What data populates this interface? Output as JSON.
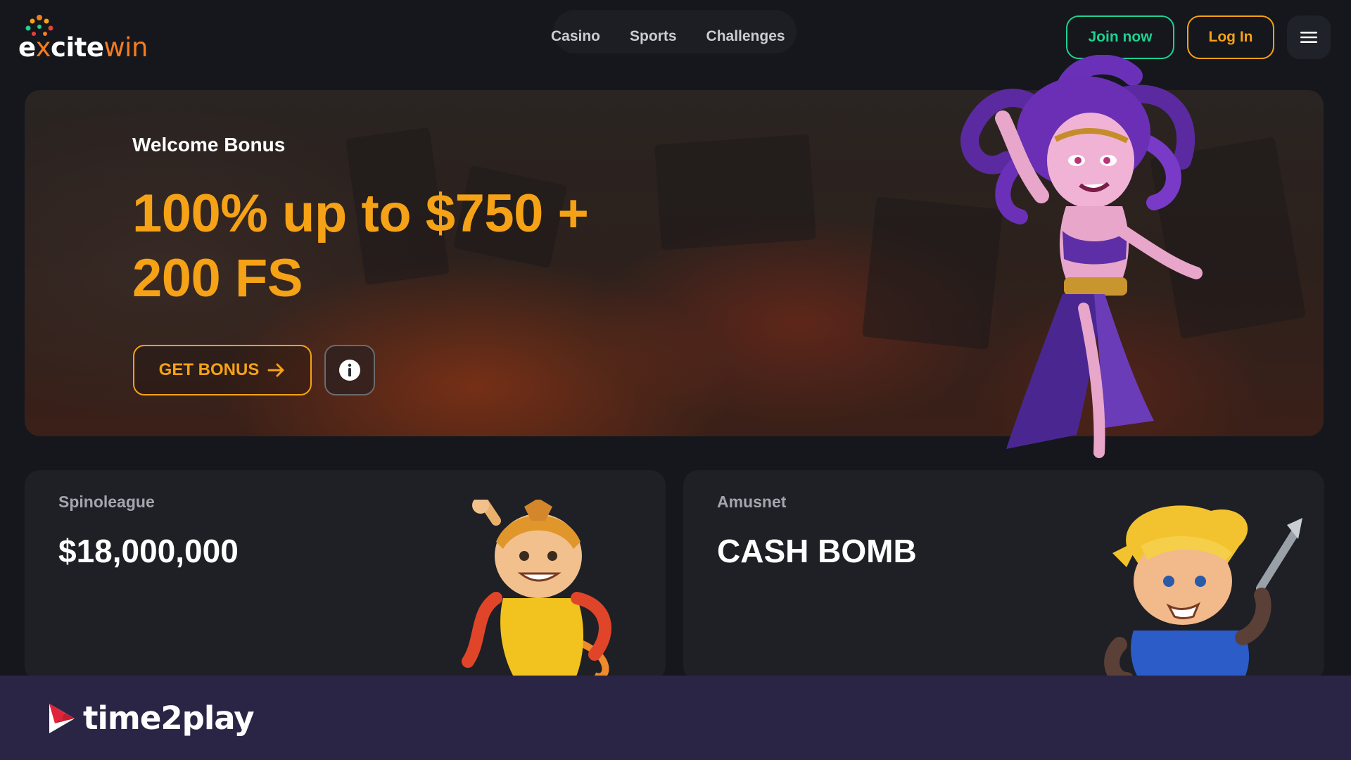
{
  "header": {
    "logo": {
      "part1": "e",
      "part2": "x",
      "part3": "cite",
      "part4": "win"
    },
    "nav": [
      {
        "label": "Casino"
      },
      {
        "label": "Sports"
      },
      {
        "label": "Challenges"
      }
    ],
    "join_label": "Join now",
    "login_label": "Log In",
    "menu_icon": "hamburger-icon"
  },
  "hero": {
    "subtitle": "Welcome Bonus",
    "title_line1": "100% up to $750 +",
    "title_line2": "200 FS",
    "cta_label": "GET BONUS",
    "cta_icon": "arrow-right-icon",
    "info_icon": "info-icon"
  },
  "cards": [
    {
      "provider": "Spinoleague",
      "title": "$18,000,000"
    },
    {
      "provider": "Amusnet",
      "title": "CASH BOMB"
    }
  ],
  "footer": {
    "brand": "time2play"
  },
  "colors": {
    "accent_orange": "#f5a216",
    "accent_green": "#1fd192",
    "logo_orange": "#f57c1f",
    "background": "#15171c",
    "footer_bg": "#2a2545"
  }
}
